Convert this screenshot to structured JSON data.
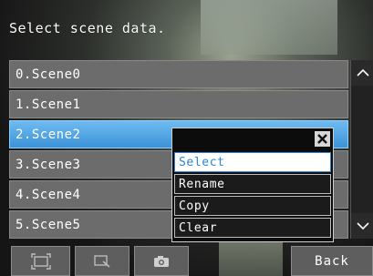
{
  "header": {
    "title": "Select scene data."
  },
  "scenes": [
    {
      "label": "0.Scene0"
    },
    {
      "label": "1.Scene1"
    },
    {
      "label": "2.Scene2"
    },
    {
      "label": "3.Scene3"
    },
    {
      "label": "4.Scene4"
    },
    {
      "label": "5.Scene5"
    }
  ],
  "selected_index": 2,
  "context_menu": {
    "items": [
      {
        "label": "Select"
      },
      {
        "label": "Rename"
      },
      {
        "label": "Copy"
      },
      {
        "label": "Clear"
      }
    ],
    "active_index": 0
  },
  "scroll": {
    "up_icon": "chevron-up-icon",
    "down_icon": "chevron-down-icon"
  },
  "toolbar": {
    "buttons": [
      {
        "icon": "fit-frame-icon"
      },
      {
        "icon": "zoom-region-icon"
      },
      {
        "icon": "camera-icon"
      }
    ],
    "back_label": "Back"
  },
  "colors": {
    "selected_row": "#3c93d8",
    "row": "#6c6c6c",
    "menu_active_text": "#2b86d3"
  }
}
